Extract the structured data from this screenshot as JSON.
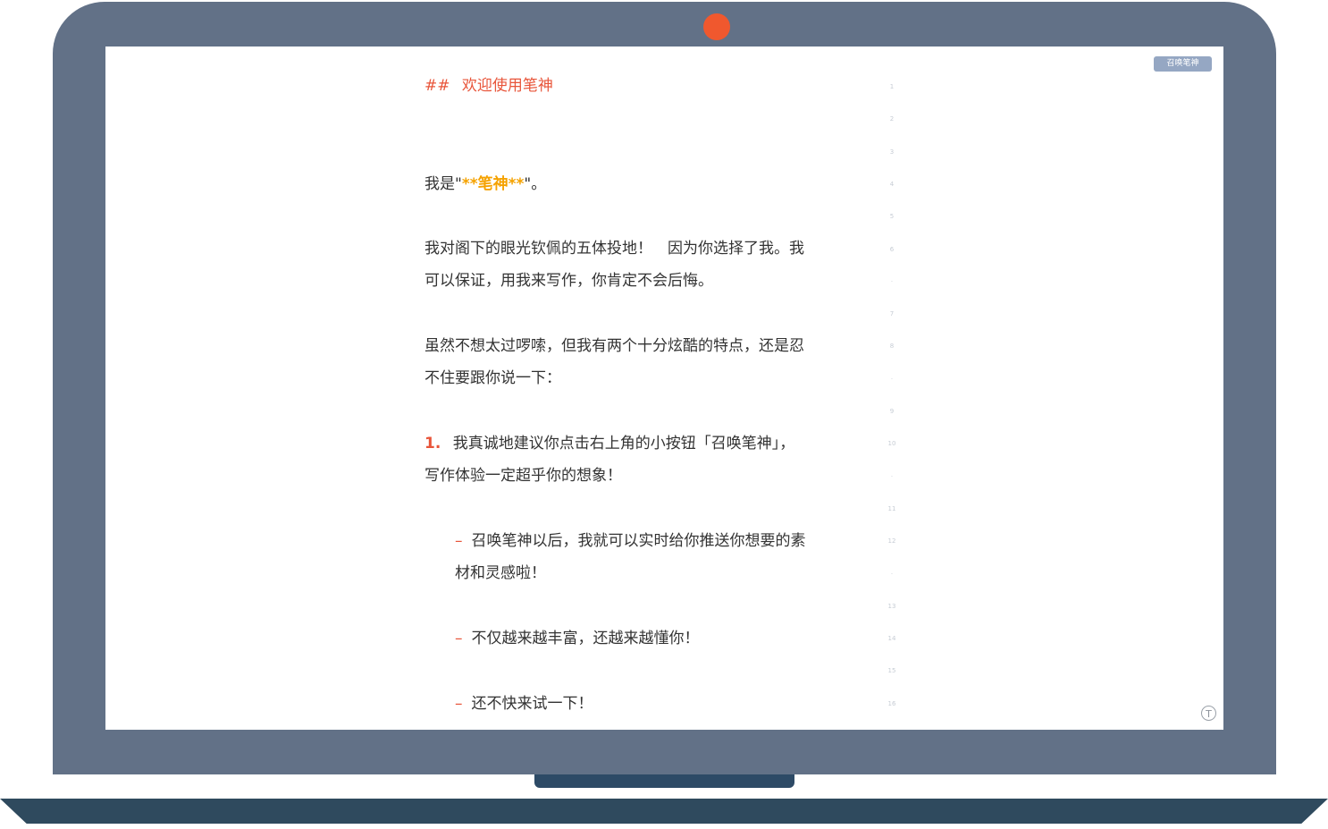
{
  "toolbar": {
    "summon_label": "召唤笔神"
  },
  "document": {
    "heading_mark": "##",
    "heading_text": "欢迎使用笔神",
    "intro_prefix": "我是\"",
    "intro_bold": "**笔神**",
    "intro_suffix": "\"。",
    "para1_line1": "我对阁下的眼光钦佩的五体投地！　因为你选择了我。我",
    "para1_line2": "可以保证，用我来写作，你肯定不会后悔。",
    "para2_line1": "虽然不想太过啰嗦，但我有两个十分炫酷的特点，还是忍",
    "para2_line2": "不住要跟你说一下：",
    "list_marker": "1.",
    "list_line1": "我真诚地建议你点击右上角的小按钮「召唤笔神」，",
    "list_line2": "写作体验一定超乎你的想象！",
    "bullet_mark": "–",
    "bullet1_line1": "召唤笔神以后，我就可以实时给你推送你想要的素",
    "bullet1_line2": "材和灵感啦！",
    "bullet2": "不仅越来越丰富，还越来越懂你！",
    "bullet3": "还不快来试一下！"
  },
  "gutter": {
    "numbers": [
      "1",
      "2",
      "3",
      "4",
      "5",
      "6",
      "·",
      "7",
      "8",
      "·",
      "9",
      "10",
      "·",
      "11",
      "12",
      "·",
      "13",
      "14",
      "15",
      "16"
    ]
  },
  "corner": {
    "icon_glyph": "T"
  },
  "colors": {
    "laptop_frame": "#627187",
    "laptop_base": "#2f4a5e",
    "camera": "#f0582e",
    "heading": "#e8553a",
    "bold": "#f5a200",
    "button": "#95a7c3"
  }
}
